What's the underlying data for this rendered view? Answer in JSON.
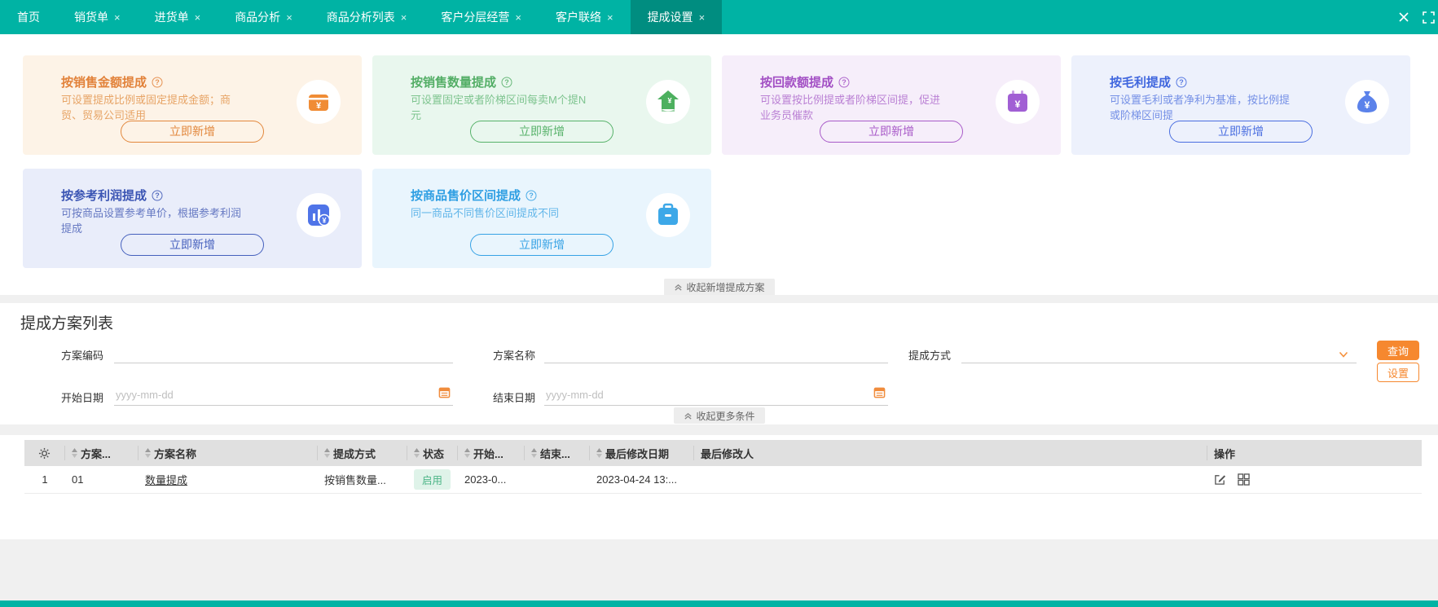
{
  "tabbar": {
    "tabs": [
      {
        "label": "首页",
        "closable": false,
        "active": false
      },
      {
        "label": "销货单",
        "closable": true,
        "active": false
      },
      {
        "label": "进货单",
        "closable": true,
        "active": false
      },
      {
        "label": "商品分析",
        "closable": true,
        "active": false
      },
      {
        "label": "商品分析列表",
        "closable": true,
        "active": false
      },
      {
        "label": "客户分层经营",
        "closable": true,
        "active": false
      },
      {
        "label": "客户联络",
        "closable": true,
        "active": false
      },
      {
        "label": "提成设置",
        "closable": true,
        "active": true
      }
    ]
  },
  "icons": {
    "tab_close_glyph": "×"
  },
  "cards": [
    {
      "title": "按销售金额提成",
      "desc": "可设置提成比例或固定提成金额；商贸、贸易公司适用",
      "button": "立即新增",
      "icon": "wallet-icon",
      "colors": {
        "bg": "#fdf3e7",
        "title": "#e2823a",
        "body": "#e7a466",
        "accent": "#e2873c",
        "glyph": "#f08c35"
      }
    },
    {
      "title": "按销售数量提成",
      "desc": "可设置固定或者阶梯区间每卖M个提N元",
      "button": "立即新增",
      "icon": "money-rise-icon",
      "colors": {
        "bg": "#e9f7ee",
        "title": "#53ae66",
        "body": "#7ec48f",
        "accent": "#57b26a",
        "glyph": "#4db05f"
      }
    },
    {
      "title": "按回款额提成",
      "desc": "可设置按比例提或者阶梯区间提，促进业务员催款",
      "button": "立即新增",
      "icon": "calendar-money-icon",
      "colors": {
        "bg": "#f6eefa",
        "title": "#a24fc4",
        "body": "#ba80d4",
        "accent": "#a85ac8",
        "glyph": "#a15fd4"
      }
    },
    {
      "title": "按毛利提成",
      "desc": "可设置毛利或者净利为基准，按比例提或阶梯区间提",
      "button": "立即新增",
      "icon": "money-bag-icon",
      "colors": {
        "bg": "#edf1fc",
        "title": "#3f66de",
        "body": "#7590e6",
        "accent": "#4a6ee0",
        "glyph": "#5b82ea"
      }
    },
    {
      "title": "按参考利润提成",
      "desc": "可按商品设置参考单价，根据参考利润提成",
      "button": "立即新增",
      "icon": "chart-money-icon",
      "colors": {
        "bg": "#e9edfa",
        "title": "#3b55b4",
        "body": "#6578c2",
        "accent": "#4560bd",
        "glyph": "#4f74e8"
      }
    },
    {
      "title": "按商品售价区间提成",
      "desc": "同一商品不同售价区间提成不同",
      "button": "立即新增",
      "icon": "briefcase-icon",
      "colors": {
        "bg": "#e9f5fd",
        "title": "#2f9fe3",
        "body": "#62b6e9",
        "accent": "#36a2e5",
        "glyph": "#3da8e8"
      }
    }
  ],
  "collapse_cards_label": "收起新增提成方案",
  "list_section": {
    "title": "提成方案列表",
    "filters": {
      "scheme_code_label": "方案编码",
      "scheme_name_label": "方案名称",
      "commission_type_label": "提成方式",
      "start_date_label": "开始日期",
      "end_date_label": "结束日期",
      "date_placeholder": "yyyy-mm-dd",
      "search_button": "查询",
      "settings_button": "设置",
      "collapse_more_label": "收起更多条件"
    },
    "table": {
      "headers": [
        "方案...",
        "方案名称",
        "提成方式",
        "状态",
        "开始...",
        "结束...",
        "最后修改日期",
        "最后修改人",
        "操作"
      ],
      "rows": [
        {
          "index": "1",
          "code": "01",
          "name": "数量提成",
          "type": "按销售数量...",
          "status": "启用",
          "start": "2023-0...",
          "end": "",
          "modified": "2023-04-24 13:...",
          "modifier_redacted": true
        }
      ]
    }
  },
  "colors": {
    "topbar_teal": "#00b3a4",
    "active_tab_teal": "#008d80",
    "primary_orange": "#f6882f",
    "status_green": "#4cb587",
    "table_header_gray": "#e0e0e0"
  }
}
